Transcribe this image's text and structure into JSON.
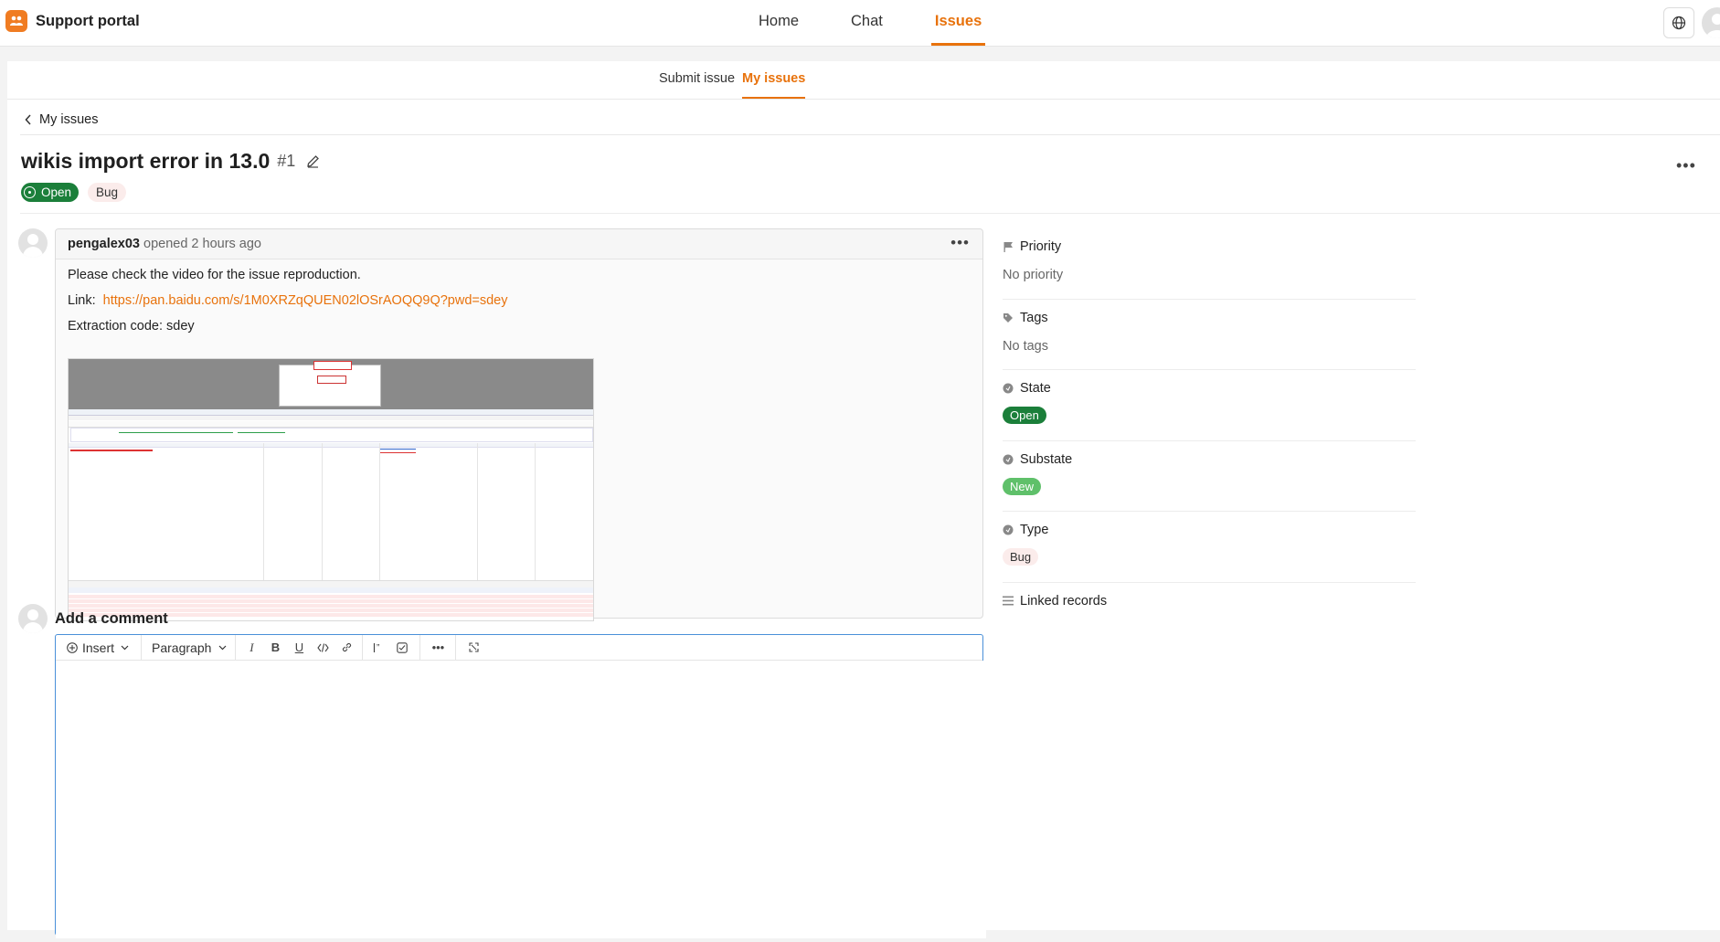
{
  "app": {
    "title": "Support portal",
    "brand_color": "#f07c22",
    "accent": "#e8720c"
  },
  "topnav": {
    "items": [
      {
        "label": "Home"
      },
      {
        "label": "Chat"
      },
      {
        "label": "Issues",
        "active": true
      }
    ]
  },
  "subnav": {
    "items": [
      {
        "label": "Submit issue"
      },
      {
        "label": "My issues",
        "active": true
      }
    ]
  },
  "breadcrumb": {
    "back_label": "My issues"
  },
  "issue": {
    "title": "wikis import error in 13.0",
    "number": "#1",
    "status": "Open",
    "type_badge": "Bug"
  },
  "comment": {
    "author": "pengalex03",
    "meta": "opened 2 hours ago",
    "line1": "Please check the video for the issue reproduction.",
    "link_label": "Link:",
    "link_url": "https://pan.baidu.com/s/1M0XRZqQUEN02lOSrAOQQ9Q?pwd=sdey",
    "extraction": "Extraction code: sdey",
    "screenshot_icon": "embedded-screenshot"
  },
  "sidebar": {
    "priority": {
      "label": "Priority",
      "value": "No priority",
      "icon": "flag-icon"
    },
    "tags": {
      "label": "Tags",
      "value": "No tags",
      "icon": "tag-icon"
    },
    "state": {
      "label": "State",
      "value": "Open",
      "icon": "state-icon"
    },
    "substate": {
      "label": "Substate",
      "value": "New",
      "icon": "substate-icon"
    },
    "type": {
      "label": "Type",
      "value": "Bug",
      "icon": "type-icon"
    },
    "linked": {
      "label": "Linked records",
      "icon": "list-icon"
    }
  },
  "add_comment": {
    "title": "Add a comment",
    "insert_label": "Insert",
    "paragraph_label": "Paragraph",
    "toolbar_icons": [
      "italic-icon",
      "bold-icon",
      "underline-icon",
      "code-icon",
      "link-icon",
      "quote-icon",
      "checklist-icon",
      "more-icon",
      "fullscreen-icon"
    ]
  },
  "colors": {
    "open_green": "#1b7f3a",
    "new_green": "#5fc06a",
    "bug_bg": "#fbeceb"
  }
}
